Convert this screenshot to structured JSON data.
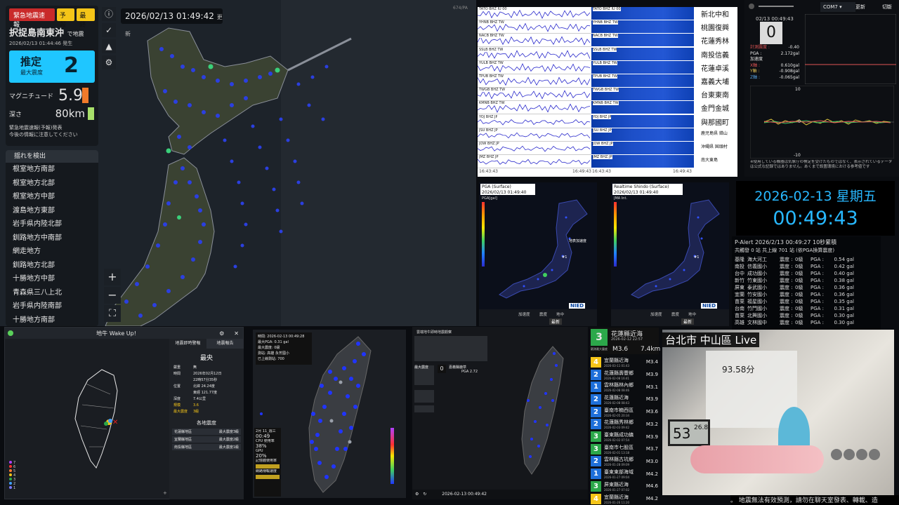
{
  "map": {
    "datetime": "2026/02/13  01:49:42",
    "update_label": "更新",
    "scale_text": "674/PA",
    "eew": {
      "badge": "緊急地震速報",
      "type": "予報",
      "final": "最終",
      "region": "択捉島南東沖",
      "region_suffix": "で地震",
      "time": "2026/02/13  01:44:46",
      "time_suffix": "発生",
      "intensity_label": "推定",
      "intensity_sub": "最大震度",
      "intensity": "2",
      "mag_label": "マグニチュード",
      "mag": "5.9",
      "depth_label": "深さ",
      "depth": "80km",
      "note1": "緊急地震速報(予報)発表",
      "note2": "今後の情報に注意してください"
    },
    "shake_title": "揺れを検出",
    "shake_list": [
      "根室地方南部",
      "根室地方北部",
      "根室地方中部",
      "渡島地方東部",
      "岩手県内陸北部",
      "釧路地方中南部",
      "網走地方",
      "釧路地方北部",
      "十勝地方中部",
      "青森県三八上北",
      "岩手県内陸南部",
      "十勝地方南部"
    ],
    "tools": [
      "info-icon",
      "pulse-icon",
      "warning-icon",
      "gear-icon"
    ],
    "zoom_in": "+",
    "zoom_out": "−",
    "fullscreen": "⛶"
  },
  "waveform": {
    "channels": [
      "TATO BHZ IU 00",
      "YHNB BHZ TW",
      "NACB BHZ TW",
      "SSLB BHZ TW",
      "YULB BHZ TW",
      "TPUB BHZ TW",
      "TWGB BHZ TW",
      "KMNB BHZ TW",
      "YOJ BHZ JP",
      "JSU BHZ JP",
      "JOW BHZ JP",
      "JMZ BHZ JP"
    ],
    "stations": [
      "新北中和",
      "桃園復興",
      "花蓮秀林",
      "南投信義",
      "花蓮卓溪",
      "嘉義大埔",
      "台東東南",
      "金門金城",
      "與那國町",
      "鹿児島県 錯山",
      "沖縄県 国頭村",
      "南大東島"
    ],
    "t_start": "16:43:43",
    "t_end": "16:49:43"
  },
  "io": {
    "port": "COM7",
    "btn_update": "更新",
    "btn_switch": "切斷",
    "timestamp": "02/13 00:49:43",
    "intensity": "0",
    "calc_label": "計測震度 :",
    "calc_val": "-0.40",
    "pga_label": "PGA :",
    "pga_val": "2.172gal",
    "accel_label": "加速度",
    "x_label": "X軸 :",
    "x_val": "0.610gal",
    "y_label": "Y軸 :",
    "y_val": "-0.908gal",
    "z_label": "Z軸 :",
    "z_val": "-0.065gal",
    "axis_top": "10",
    "axis_zero": "0",
    "axis_bot": "-10",
    "disclaimer": "※使用している機器は気象庁の検定を受けたものではなく、表示されているデータは公式な記録ではありません。あくまで設置環境における参考値です"
  },
  "pga_panel": {
    "title1": "PGA (Surface)",
    "date1": "2026/02/13 01:49:40",
    "unit1": "PGA[gal]",
    "title2": "Realtime Shindo (Surface)",
    "date2": "2026/02/13 01:49:40",
    "unit2": "JMA Int.",
    "legend": "地表加速度",
    "marker": "#1",
    "logo": "NIED",
    "radio": [
      "加速度",
      "震度",
      "地中"
    ],
    "btn": "最新"
  },
  "clock": {
    "date": "2026-02-13 星期五",
    "time": "00:49:43"
  },
  "palert": {
    "title": "P-Alert 2026/2/13 00:49:27 10秒累積",
    "subtitle": "共觸發 0 站 共上線 701 站 (依PGA換算震度)",
    "rows": [
      [
        "基隆",
        "海大河工",
        "0級",
        "0.54 gal"
      ],
      [
        "南投",
        "信義國小",
        "0級",
        "0.42 gal"
      ],
      [
        "台中",
        "成功國小",
        "0級",
        "0.40 gal"
      ],
      [
        "新竹",
        "竹東國小",
        "0級",
        "0.38 gal"
      ],
      [
        "屏東",
        "泰武國小",
        "0級",
        "0.36 gal"
      ],
      [
        "宜蘭",
        "竹安國小",
        "0級",
        "0.36 gal"
      ],
      [
        "苗栗",
        "福星國小",
        "0級",
        "0.35 gal"
      ],
      [
        "台南",
        "竹門國小",
        "0級",
        "0.31 gal"
      ],
      [
        "苗栗",
        "北興國小",
        "0級",
        "0.30 gal"
      ],
      [
        "高雄",
        "文林國中",
        "0級",
        "0.30 gal"
      ]
    ],
    "intensity_label": "震度 :",
    "pga_label": "PGA :"
  },
  "wake": {
    "title": "地牛 Wake Up!",
    "tab1": "地震即時警報",
    "tab2": "地震報告",
    "report_title": "最央",
    "fields": [
      [
        "嚴重",
        "無"
      ],
      [
        "時間",
        "2026年02月12日"
      ],
      [
        "",
        "22時57分35秒"
      ],
      [
        "位置",
        "北緯 24.24度"
      ],
      [
        "",
        "東經 121.77度"
      ],
      [
        "深度",
        "7.4公里"
      ],
      [
        "規模",
        "3.6"
      ],
      [
        "最大震度",
        "3級"
      ]
    ],
    "area_title": "各地震度",
    "areas": [
      [
        "花蓮縣地區",
        "最大震度3級"
      ],
      [
        "宜蘭縣地區",
        "最大震度2級"
      ],
      [
        "南投縣地區",
        "最大震度1級"
      ]
    ],
    "legend": [
      "7",
      "6",
      "5",
      "4",
      "3",
      "2",
      "1"
    ]
  },
  "tw1": {
    "time": "時間: 2026-02-13 00:49:28",
    "pga": "最大PGA: 0.31 gal",
    "max_int": "最大震度: 0級",
    "station": "測站: 高雄 永芳國小",
    "online": "已上線測站: 700",
    "date_box": "2月 11_週三",
    "clock_box": "00:49",
    "cpu_label": "CPU 使用率",
    "cpu": "38%",
    "gpu_label": "GPU",
    "gpu": "20%",
    "extra1": "記憶體使用率",
    "extra2": "網路傳輸速度"
  },
  "tw2": {
    "title": "雲端地牛即時地震觀察",
    "int_label": "最大震度",
    "int_val": "0",
    "station": "嘉義縣鹿草",
    "pga": "PGA 2.72",
    "rows": [
      "—",
      "—",
      "—",
      "—"
    ],
    "date": "2026-02-13 00:49:42"
  },
  "quakes": {
    "head_level": "3",
    "head_loc": "花蓮縣近海",
    "head_date": "2026-02-12 22:57",
    "head_mag": "M3.6",
    "head_depth": "7.4km",
    "head_label": "觀測最大震度",
    "items": [
      [
        "4",
        "宜蘭縣近海",
        "2026-03-11 01:43",
        "M3.4",
        "#f5c518"
      ],
      [
        "2",
        "花蓮縣壽豐鄉",
        "2026-02-08 16:41",
        "M3.9",
        "#1e6fd9"
      ],
      [
        "1",
        "雲林縣林內鄉",
        "2026-02-08 08:46",
        "M3.1",
        "#1e6fd9"
      ],
      [
        "2",
        "花蓮縣近海",
        "2026-02-08 08:43",
        "M3.9",
        "#1e6fd9"
      ],
      [
        "2",
        "臺南市楠西區",
        "2026-02-05 20:34",
        "M3.6",
        "#1e6fd9"
      ],
      [
        "2",
        "花蓮縣秀林鄉",
        "2026-02-03 09:42",
        "M3.2",
        "#1e6fd9"
      ],
      [
        "3",
        "臺東縣成功鎮",
        "2026-02-02 07:54",
        "M3.9",
        "#2ca84a"
      ],
      [
        "3",
        "臺南市七股區",
        "2026-02-01 13:18",
        "M3.7",
        "#2ca84a"
      ],
      [
        "2",
        "雲林縣古坑鄉",
        "2026-01-28 09:09",
        "M3.0",
        "#1e6fd9"
      ],
      [
        "1",
        "臺東東部海域",
        "2026-01-27 09:04",
        "M4.2",
        "#1e6fd9"
      ],
      [
        "3",
        "屏東縣近海",
        "2026-01-27 07:02",
        "M4.6",
        "#2ca84a"
      ],
      [
        "4",
        "宜蘭縣近海",
        "2026-01-26 11:20",
        "M4.2",
        "#f5c518"
      ]
    ]
  },
  "live": {
    "title": "台北市 中山區 Live",
    "thermo_big": "53",
    "thermo_small": "26.8",
    "note": "93.58分"
  },
  "ticker": "。 地震無法有效預測，請勿在聊天室發表、轉載、造"
}
